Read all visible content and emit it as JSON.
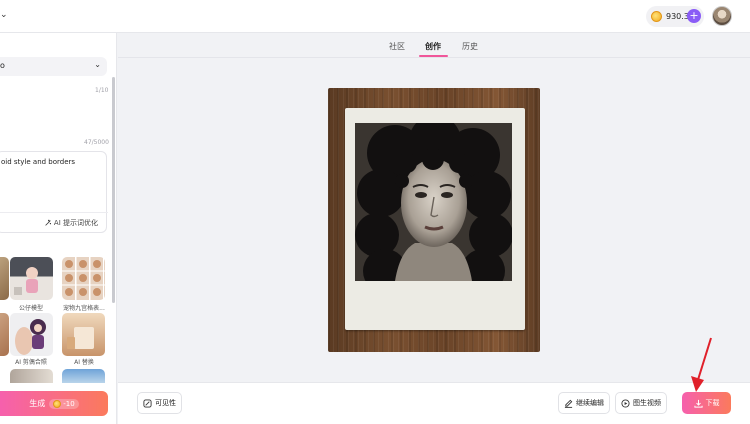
{
  "topbar": {
    "credits": "930.3",
    "plus": "+"
  },
  "left": {
    "model_value": "o",
    "title_count": "1/10",
    "prompt_count": "47/5000",
    "prompt_text": "oid style and borders",
    "ai_optimize": "AI 提示词优化",
    "templates": [
      {
        "label": ""
      },
      {
        "label": "公仔模型"
      },
      {
        "label": "宠物九宫格表..."
      },
      {
        "label": ""
      },
      {
        "label": "AI 剪偶合照"
      },
      {
        "label": "AI 替换"
      }
    ],
    "generate_label": "生成",
    "generate_cost": "-10"
  },
  "tabs": [
    {
      "label": "社区",
      "active": false
    },
    {
      "label": "创作",
      "active": true
    },
    {
      "label": "历史",
      "active": false
    }
  ],
  "bottom": {
    "visibility": "可见性",
    "continue_edit": "继续编辑",
    "image_to_video": "图生视频",
    "download": "下载"
  },
  "colors": {
    "accent": "#f660ad",
    "accent2": "#fb7a5c",
    "purple": "#8a5cf6",
    "annotation_arrow": "#e0202a"
  }
}
